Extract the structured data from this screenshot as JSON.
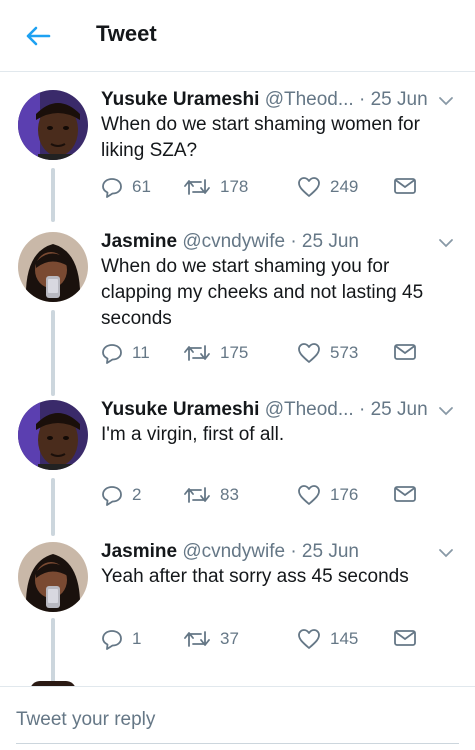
{
  "header": {
    "title": "Tweet",
    "back_icon": "arrow-left-icon",
    "accent": "#1da1f2"
  },
  "tweets": [
    {
      "name": "Yusuke Urameshi",
      "handle": "@Theod...",
      "date": "· 25 Jun",
      "text": "When do we start shaming women for liking SZA?",
      "replies": "61",
      "retweets": "178",
      "likes": "249"
    },
    {
      "name": "Jasmine",
      "handle": "@cvndywife",
      "date": "· 25 Jun",
      "text": "When do we start shaming you for clapping my cheeks and not lasting 45 seconds",
      "replies": "11",
      "retweets": "175",
      "likes": "573"
    },
    {
      "name": "Yusuke Urameshi",
      "handle": "@Theod...",
      "date": "· 25 Jun",
      "text": "I'm a virgin, first of all.",
      "replies": "2",
      "retweets": "83",
      "likes": "176"
    },
    {
      "name": "Jasmine",
      "handle": "@cvndywife",
      "date": "· 25 Jun",
      "text": "Yeah after that sorry ass 45 seconds",
      "replies": "1",
      "retweets": "37",
      "likes": "145"
    }
  ],
  "reply_bar": {
    "placeholder": "Tweet your reply"
  },
  "colors": {
    "text": "#14171a",
    "secondary": "#657786",
    "thread_line": "#ccd6dd",
    "divider": "#e1e8ed"
  }
}
